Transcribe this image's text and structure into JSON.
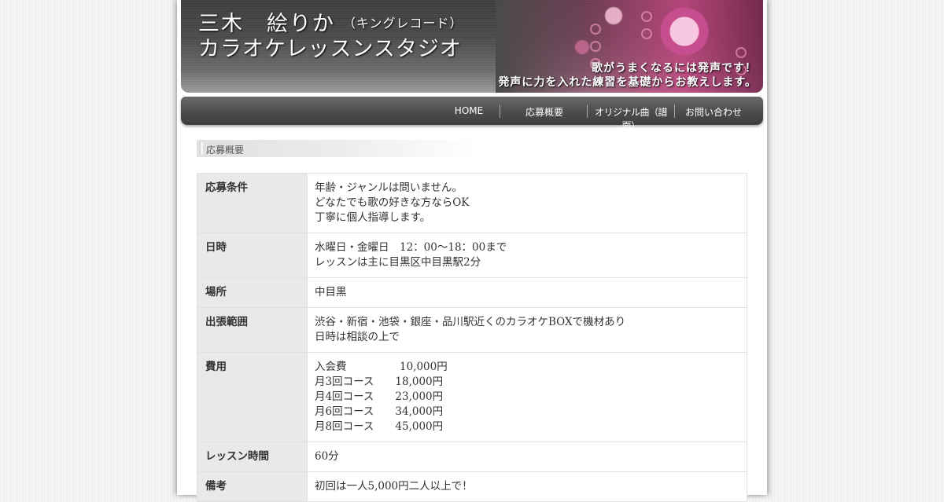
{
  "header": {
    "title_name": "三木　絵りか",
    "title_label": "（キングレコード）",
    "title_studio": "カラオケレッスンスタジオ",
    "tagline_1": "歌がうまくなるには発声です！",
    "tagline_2": "発声に力を入れた練習を基礎からお教えします。"
  },
  "nav": {
    "items": [
      {
        "label": "HOME"
      },
      {
        "label": "応募概要"
      },
      {
        "label": "オリジナル曲（譜面）"
      },
      {
        "label": "お問い合わせ"
      }
    ]
  },
  "breadcrumb": {
    "label": "応募概要"
  },
  "table": {
    "rows": [
      {
        "label": "応募条件",
        "lines": [
          "年齢・ジャンルは問いません。",
          "どなたでも歌の好きな方ならOK",
          "丁寧に個人指導します。"
        ]
      },
      {
        "label": "日時",
        "lines": [
          "水曜日・金曜日　12：00～18：00まで",
          "レッスンは主に目黒区中目黒駅2分"
        ]
      },
      {
        "label": "場所",
        "lines": [
          "中目黒"
        ]
      },
      {
        "label": "出張範囲",
        "lines": [
          "渋谷・新宿・池袋・銀座・品川駅近くのカラオケBOXで機材あり",
          "日時は相談の上で"
        ]
      },
      {
        "label": "費用",
        "lines": [
          "入会費　　　　　10,000円",
          "月3回コース　　18,000円",
          "月4回コース　　23,000円",
          "月6回コース　　34,000円",
          "月8回コース　　45,000円"
        ]
      },
      {
        "label": "レッスン時間",
        "lines": [
          "60分"
        ]
      },
      {
        "label": "備考",
        "lines": [
          "初回は一人5,000円二人以上で！"
        ]
      }
    ]
  }
}
